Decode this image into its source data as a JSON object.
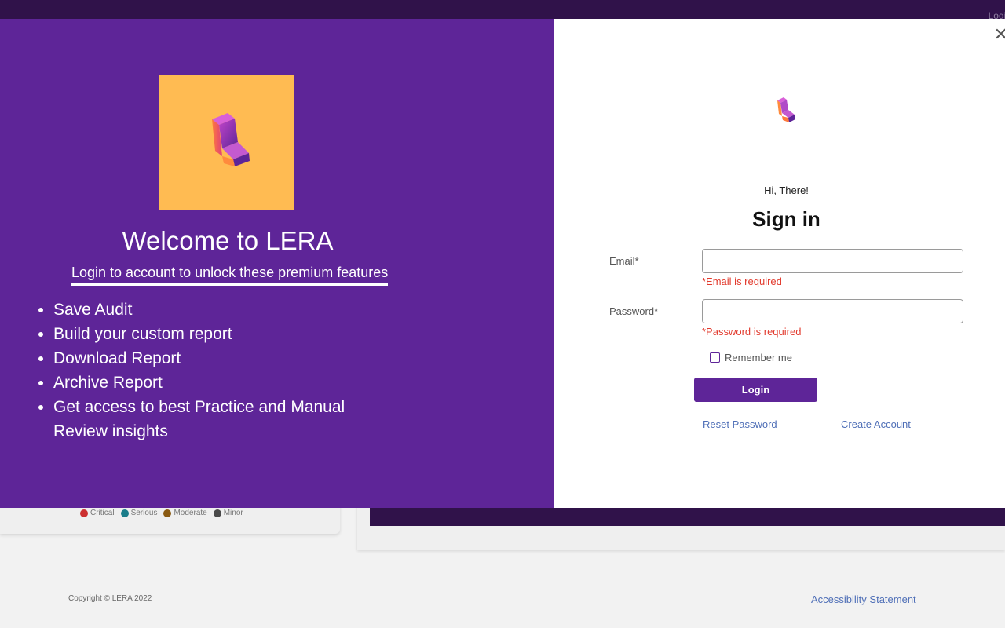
{
  "background": {
    "topbar_login": "Login",
    "legend": [
      {
        "label": "Critical",
        "color": "#cc3030"
      },
      {
        "label": "Serious",
        "color": "#1a7d8a"
      },
      {
        "label": "Moderate",
        "color": "#8a5a12"
      },
      {
        "label": "Minor",
        "color": "#4a4a4a"
      }
    ],
    "footer_copyright": "Copyright © LERA 2022",
    "footer_link": "Accessibility Statement"
  },
  "welcome": {
    "title": "Welcome to LERA",
    "subtitle": "Login to account to unlock these premium features",
    "features": [
      "Save Audit",
      "Build your custom report",
      "Download Report",
      "Archive Report",
      "Get access to best Practice and Manual Review insights"
    ]
  },
  "signin": {
    "close_icon": "close-icon",
    "greeting": "Hi, There!",
    "title": "Sign in",
    "email_label": "Email*",
    "email_value": "",
    "email_error": "*Email is required",
    "password_label": "Password*",
    "password_value": "",
    "password_error": "*Password is required",
    "remember_label": "Remember me",
    "remember_checked": false,
    "login_label": "Login",
    "reset_link": "Reset Password",
    "create_link": "Create Account"
  },
  "colors": {
    "brand_purple": "#5e2598",
    "logo_yellow": "#ffbb52",
    "error_red": "#e23b2e",
    "link_blue": "#4f6fb7"
  }
}
